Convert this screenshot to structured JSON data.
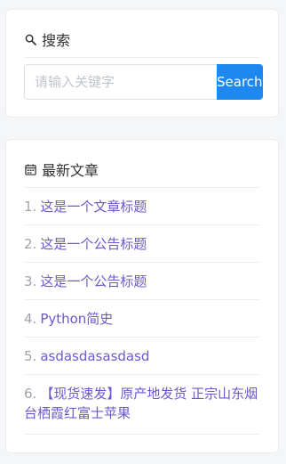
{
  "search": {
    "title": "搜索",
    "icon": "search-icon",
    "placeholder": "请输入关键字",
    "value": "",
    "button_label": "Search",
    "button_color": "#1e87f0"
  },
  "articles": {
    "title": "最新文章",
    "icon": "calendar-icon",
    "link_color": "#6a5acd",
    "items": [
      {
        "num": "1.",
        "title": "这是一个文章标题"
      },
      {
        "num": "2.",
        "title": "这是一个公告标题"
      },
      {
        "num": "3.",
        "title": "这是一个公告标题"
      },
      {
        "num": "4.",
        "title": "Python简史"
      },
      {
        "num": "5.",
        "title": "asdasdasasdasd"
      },
      {
        "num": "6.",
        "title": "【现货速发】原产地发货 正宗山东烟台栖霞红富士苹果"
      }
    ]
  }
}
